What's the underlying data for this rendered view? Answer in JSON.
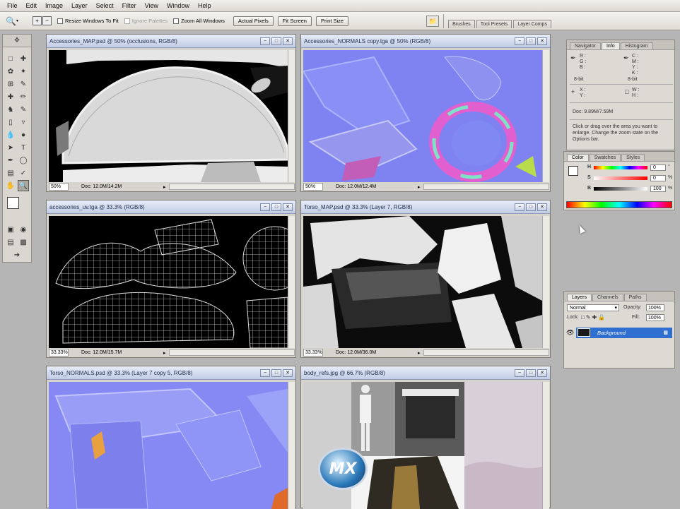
{
  "menu": [
    "File",
    "Edit",
    "Image",
    "Layer",
    "Select",
    "Filter",
    "View",
    "Window",
    "Help"
  ],
  "options_bar": {
    "resize_windows": "Resize Windows To Fit",
    "ignore_palettes": "Ignore Palettes",
    "zoom_all": "Zoom All Windows",
    "actual_pixels": "Actual Pixels",
    "fit_screen": "Fit Screen",
    "print_size": "Print Size",
    "well_tabs": [
      "Brushes",
      "Tool Presets",
      "Layer Comps"
    ]
  },
  "documents": [
    {
      "title": "Accessories_MAP.psd @ 50% (occlusions, RGB/8)",
      "zoom": "50%",
      "doc": "Doc: 12.0M/14.2M"
    },
    {
      "title": "Accessories_NORMALS copy.tga @ 50% (RGB/8)",
      "zoom": "50%",
      "doc": "Doc: 12.0M/12.4M"
    },
    {
      "title": "accessories_uv.tga @ 33.3% (RGB/8)",
      "zoom": "33.33%",
      "doc": "Doc: 12.0M/15.7M"
    },
    {
      "title": "Torso_MAP.psd @ 33.3% (Layer 7, RGB/8)",
      "zoom": "33.33%",
      "doc": "Doc: 12.0M/36.0M"
    },
    {
      "title": "Torso_NORMALS.psd @ 33.3% (Layer 7 copy 5, RGB/8)",
      "zoom": "",
      "doc": ""
    },
    {
      "title": "body_refs.jpg @ 66.7% (RGB/8)",
      "zoom": "",
      "doc": ""
    }
  ],
  "info_panel": {
    "tabs": [
      "Navigator",
      "Info",
      "Histogram"
    ],
    "rgb": [
      "R :",
      "G :",
      "B :"
    ],
    "cmyk": [
      "C :",
      "M :",
      "Y :",
      "K :"
    ],
    "bit_left": "8-bit",
    "bit_right": "8-bit",
    "xy": [
      "X :",
      "Y :"
    ],
    "wh": [
      "W :",
      "H :"
    ],
    "doc": "Doc: 9.89M/7.59M",
    "help": "Click or drag over the area you want to enlarge. Change the zoom state on the Options bar."
  },
  "color_panel": {
    "tabs": [
      "Color",
      "Swatches",
      "Styles"
    ],
    "h_label": "H",
    "h_value": "0",
    "s_label": "S",
    "s_value": "0",
    "b_label": "B",
    "b_value": "100",
    "units": [
      "°",
      "%",
      "%"
    ]
  },
  "layers_panel": {
    "tabs": [
      "Layers",
      "Channels",
      "Paths"
    ],
    "mode": "Normal",
    "opacity_label": "Opacity:",
    "opacity": "100%",
    "lock_label": "Lock:",
    "fill_label": "Fill:",
    "fill": "100%",
    "layer": "Background"
  },
  "watermark": "MX"
}
